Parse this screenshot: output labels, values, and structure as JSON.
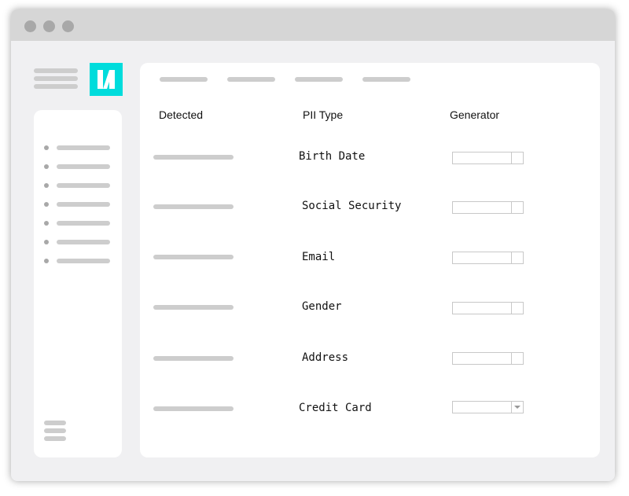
{
  "logo": {
    "text": "N",
    "color": "#00dcdc"
  },
  "table": {
    "headers": {
      "detected": "Detected",
      "pii_type": "PII Type",
      "generator": "Generator"
    },
    "rows": [
      {
        "pii_type": "Birth Date"
      },
      {
        "pii_type": "Social Security"
      },
      {
        "pii_type": "Email"
      },
      {
        "pii_type": "Gender"
      },
      {
        "pii_type": "Address"
      },
      {
        "pii_type": "Credit Card"
      }
    ]
  }
}
